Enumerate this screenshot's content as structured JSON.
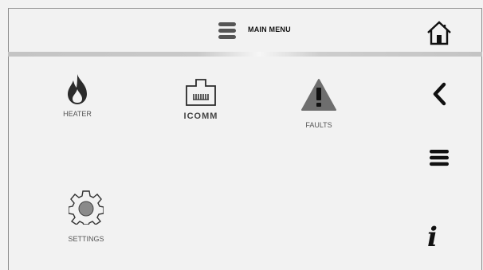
{
  "header": {
    "title": "MAIN MENU"
  },
  "tiles": [
    {
      "label": "HEATER",
      "icon": "flame-icon"
    },
    {
      "label": "ICOMM",
      "icon": "network-port-icon"
    },
    {
      "label": "FAULTS",
      "icon": "warning-icon"
    },
    {
      "label": "SETTINGS",
      "icon": "gear-icon"
    }
  ],
  "side_nav": {
    "home_icon": "home-icon",
    "back_icon": "chevron-left-icon",
    "menu_icon": "hamburger-menu-icon",
    "info_glyph": "i"
  },
  "colors": {
    "background": "#f2f2f2",
    "icon": "#2b2b2b",
    "label": "#555555"
  }
}
